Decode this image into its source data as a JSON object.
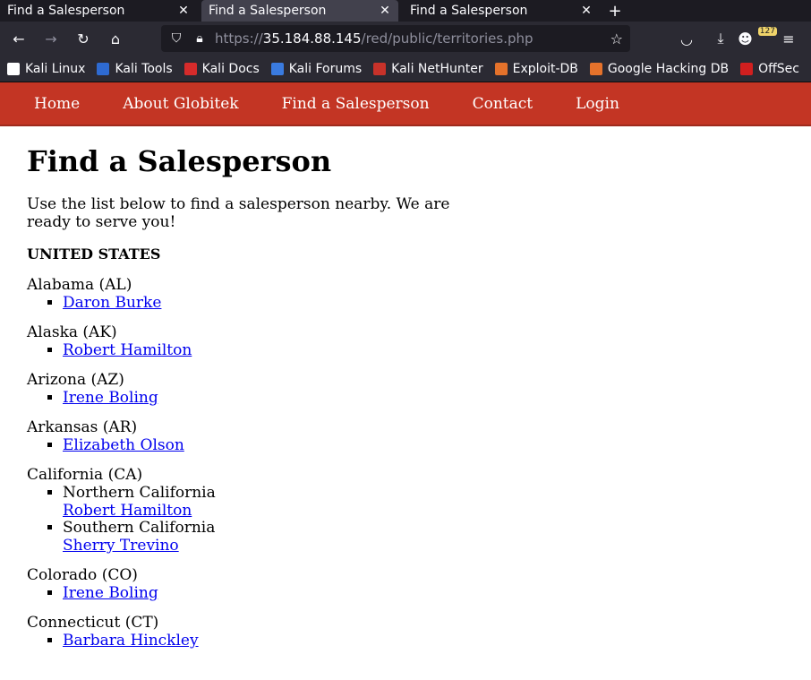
{
  "browser": {
    "tabs": [
      {
        "title": "Find a Salesperson",
        "active": false
      },
      {
        "title": "Find a Salesperson",
        "active": true
      },
      {
        "title": "Find a Salesperson",
        "active": false
      }
    ],
    "url_scheme": "https://",
    "url_host": "35.184.88.145",
    "url_path": "/red/public/territories.php",
    "extension_badge": "127",
    "bookmarks": [
      {
        "label": "Kali Linux",
        "color": "#ffffff"
      },
      {
        "label": "Kali Tools",
        "color": "#2e6ad1"
      },
      {
        "label": "Kali Docs",
        "color": "#d62b2b"
      },
      {
        "label": "Kali Forums",
        "color": "#3a7be0"
      },
      {
        "label": "Kali NetHunter",
        "color": "#c8322a"
      },
      {
        "label": "Exploit-DB",
        "color": "#e5722b"
      },
      {
        "label": "Google Hacking DB",
        "color": "#e5722b"
      },
      {
        "label": "OffSec",
        "color": "#d11f1f"
      }
    ]
  },
  "site": {
    "nav": [
      "Home",
      "About Globitek",
      "Find a Salesperson",
      "Contact",
      "Login"
    ],
    "accent": "#c33524"
  },
  "page": {
    "title": "Find a Salesperson",
    "intro": "Use the list below to find a salesperson nearby. We are ready to serve you!",
    "country": "UNITED STATES",
    "states": [
      {
        "name": "Alabama (AL)",
        "items": [
          {
            "region": "",
            "person": "Daron Burke"
          }
        ]
      },
      {
        "name": "Alaska (AK)",
        "items": [
          {
            "region": "",
            "person": "Robert Hamilton"
          }
        ]
      },
      {
        "name": "Arizona (AZ)",
        "items": [
          {
            "region": "",
            "person": "Irene Boling"
          }
        ]
      },
      {
        "name": "Arkansas (AR)",
        "items": [
          {
            "region": "",
            "person": "Elizabeth Olson"
          }
        ]
      },
      {
        "name": "California (CA)",
        "items": [
          {
            "region": "Northern California",
            "person": "Robert Hamilton"
          },
          {
            "region": "Southern California",
            "person": "Sherry Trevino"
          }
        ]
      },
      {
        "name": "Colorado (CO)",
        "items": [
          {
            "region": "",
            "person": "Irene Boling"
          }
        ]
      },
      {
        "name": "Connecticut (CT)",
        "items": [
          {
            "region": "",
            "person": "Barbara Hinckley"
          }
        ]
      }
    ]
  }
}
